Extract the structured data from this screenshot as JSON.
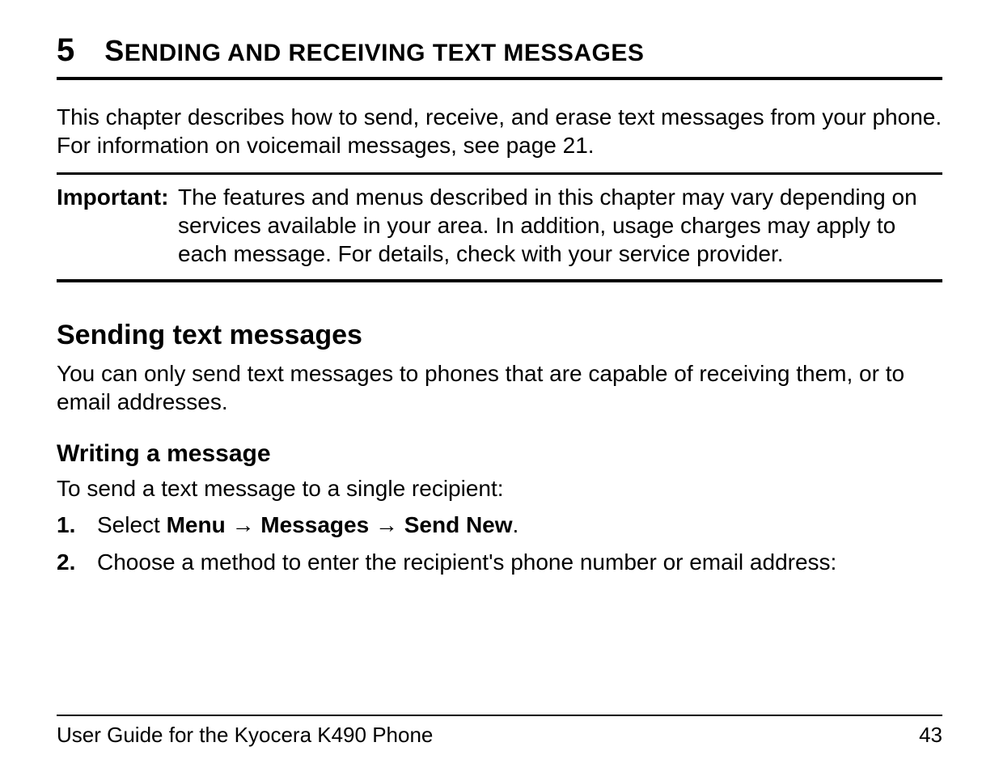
{
  "chapter": {
    "number": "5",
    "title_first": "S",
    "title_rest": "ENDING AND RECEIVING TEXT MESSAGES"
  },
  "intro": "This chapter describes how to send, receive, and erase text messages from your phone. For information on voicemail messages, see page 21.",
  "important": {
    "label": "Important:",
    "text": "The features and menus described in this chapter may vary depending on services available in your area. In addition, usage charges may apply to each message. For details, check with your service provider."
  },
  "section1": {
    "heading": "Sending text messages",
    "body": "You can only send text messages to phones that are capable of receiving them, or to email addresses."
  },
  "section2": {
    "heading": "Writing a message",
    "lead": "To send a text message to a single recipient:"
  },
  "steps": {
    "s1_num": "1.",
    "s1_pre": "Select ",
    "s1_menu": "Menu",
    "s1_arrow1": " → ",
    "s1_messages": "Messages",
    "s1_arrow2": " → ",
    "s1_sendnew": "Send New",
    "s1_post": ".",
    "s2_num": "2.",
    "s2_text": "Choose a method to enter the recipient's phone number or email address:"
  },
  "footer": {
    "left": "User Guide for the Kyocera K490 Phone",
    "right": "43"
  }
}
